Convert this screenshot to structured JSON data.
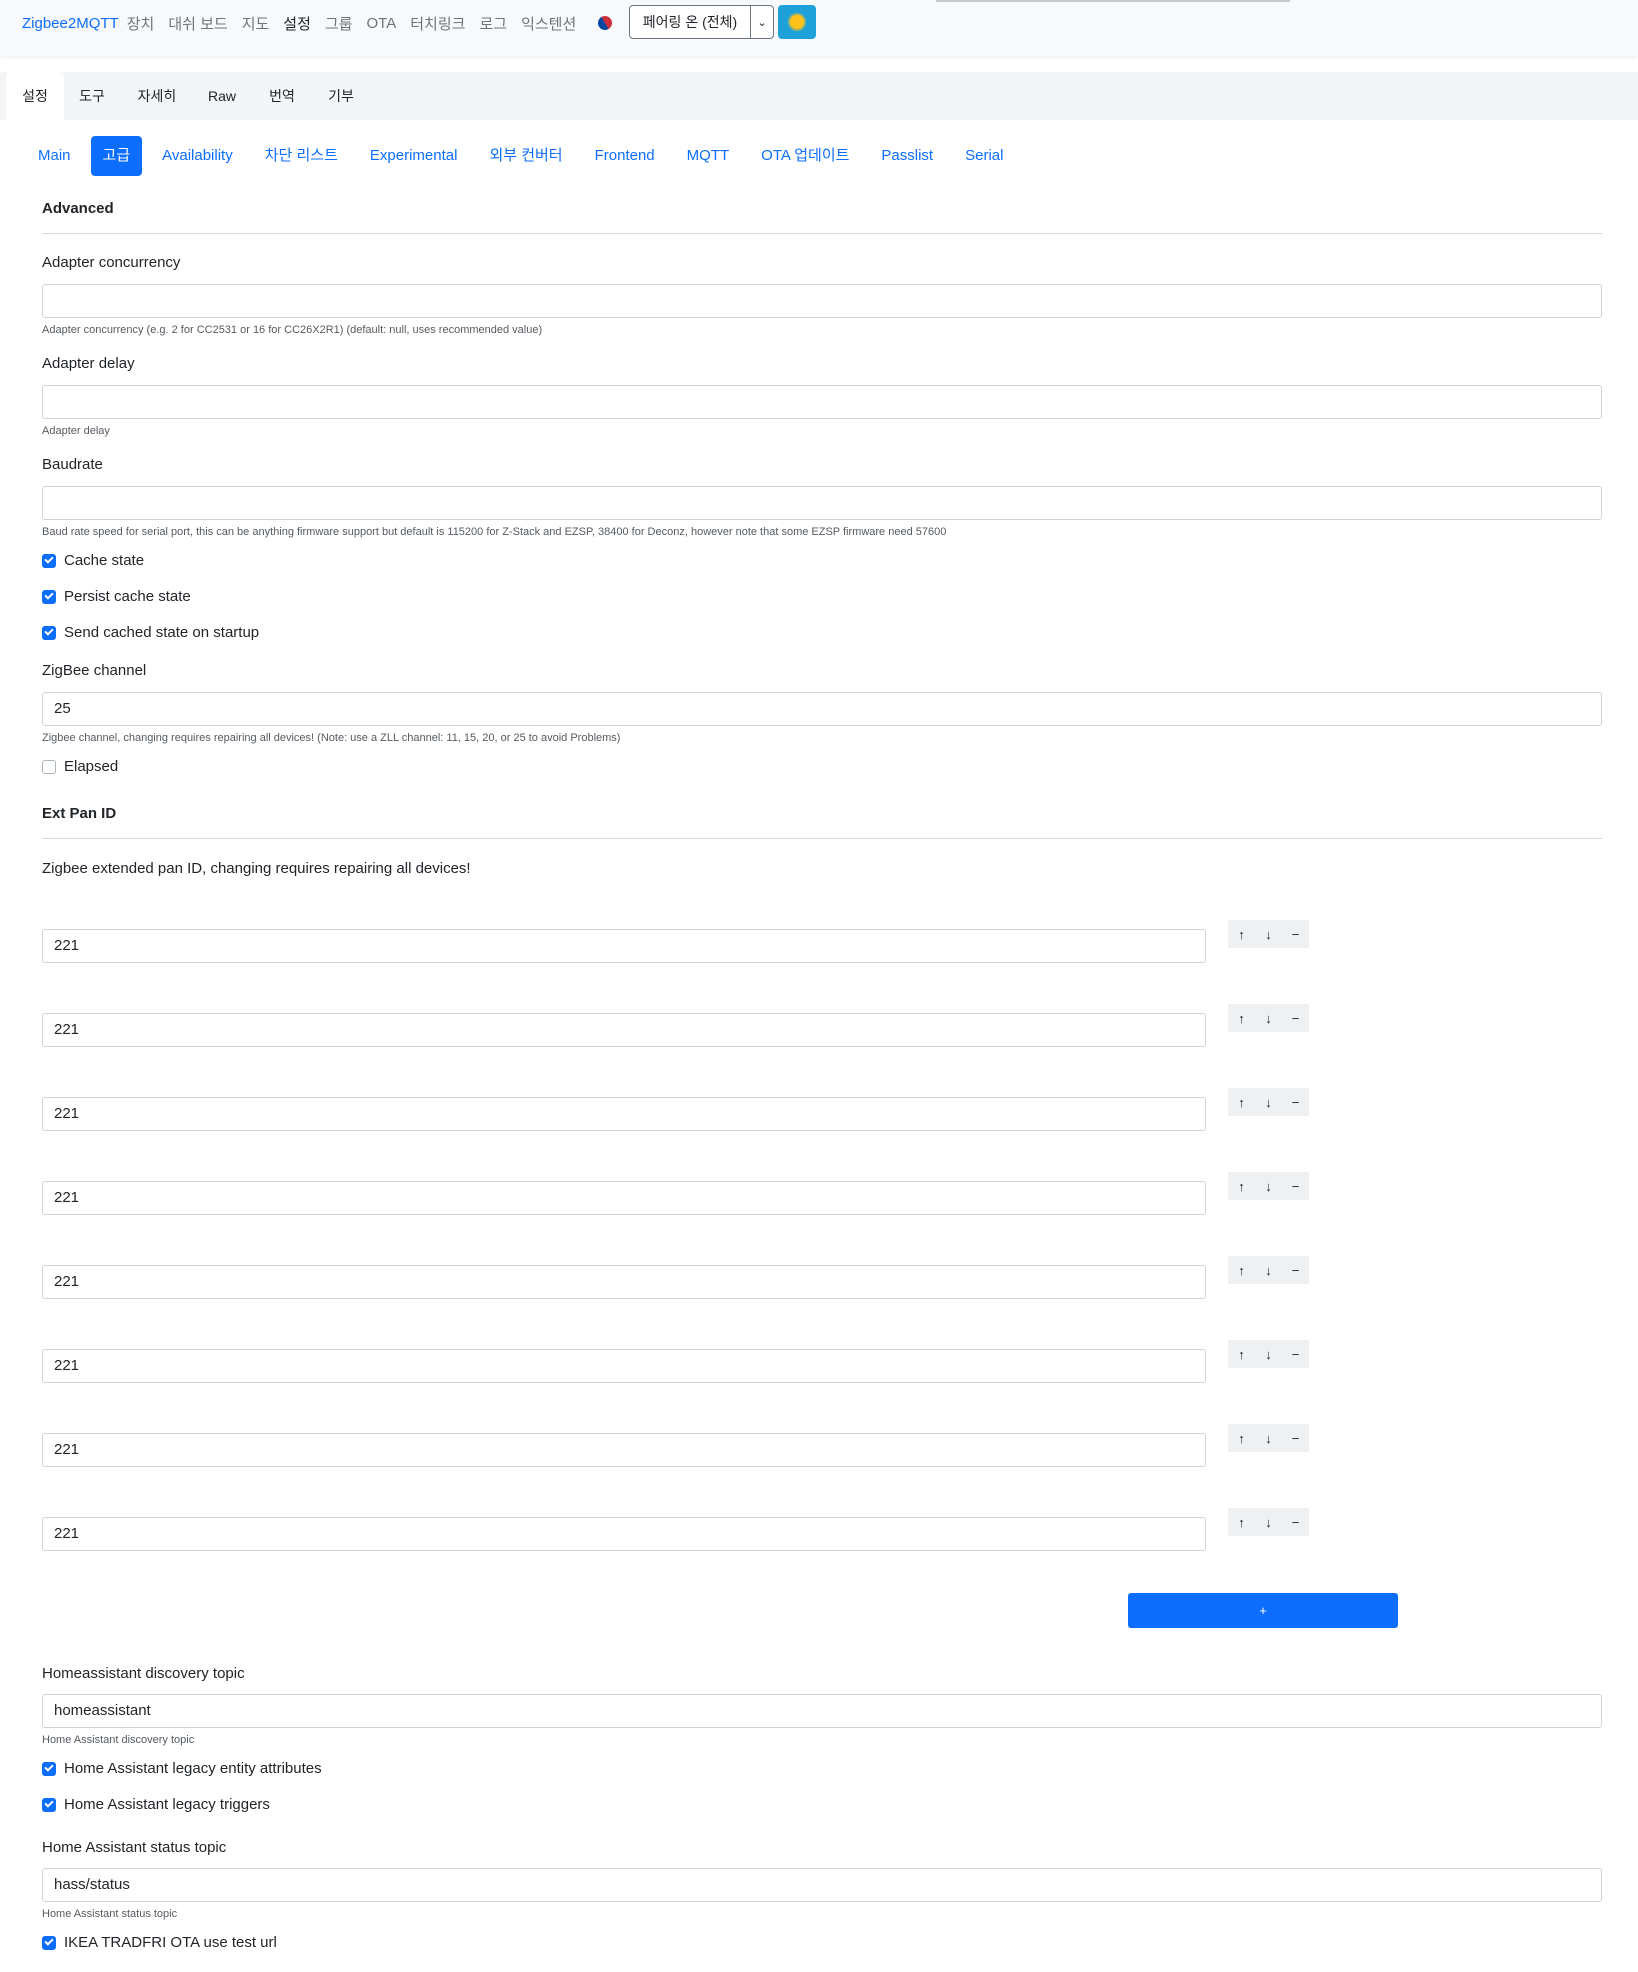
{
  "navbar": {
    "brand": "Zigbee2MQTT",
    "links": [
      "장치",
      "대쉬 보드",
      "지도",
      "설정",
      "그룹",
      "OTA",
      "터치링크",
      "로그",
      "익스텐션"
    ],
    "active_link": "설정",
    "permit_join_label": "페어링 온 (전체)"
  },
  "tabs_top": [
    "설정",
    "도구",
    "자세히",
    "Raw",
    "번역",
    "기부"
  ],
  "tabs_settings": [
    "Main",
    "고급",
    "Availability",
    "차단 리스트",
    "Experimental",
    "외부 컨버터",
    "Frontend",
    "MQTT",
    "OTA 업데이트",
    "Passlist",
    "Serial"
  ],
  "form": {
    "legend": "Advanced",
    "adapter_concurrency": {
      "label": "Adapter concurrency",
      "value": "",
      "help": "Adapter concurrency (e.g. 2 for CC2531 or 16 for CC26X2R1) (default: null, uses recommended value)"
    },
    "adapter_delay": {
      "label": "Adapter delay",
      "value": "",
      "help": "Adapter delay"
    },
    "baudrate": {
      "label": "Baudrate",
      "value": "",
      "help": "Baud rate speed for serial port, this can be anything firmware support but default is 115200 for Z-Stack and EZSP, 38400 for Deconz, however note that some EZSP firmware need 57600"
    },
    "cache_state": {
      "label": "Cache state",
      "checked": true
    },
    "persist_cache_state": {
      "label": "Persist cache state",
      "checked": true
    },
    "send_cached_state": {
      "label": "Send cached state on startup",
      "checked": true
    },
    "zigbee_channel": {
      "label": "ZigBee channel",
      "value": "25",
      "help": "Zigbee channel, changing requires repairing all devices! (Note: use a ZLL channel: 11, 15, 20, or 25 to avoid Problems)"
    },
    "elapsed": {
      "label": "Elapsed",
      "checked": false
    },
    "ext_pan_id": {
      "legend": "Ext Pan ID",
      "description": "Zigbee extended pan ID, changing requires repairing all devices!",
      "values": [
        "221",
        "221",
        "221",
        "221",
        "221",
        "221",
        "221",
        "221"
      ],
      "add_label": "+"
    },
    "ha_discovery_topic": {
      "label": "Homeassistant discovery topic",
      "value": "homeassistant",
      "help": "Home Assistant discovery topic"
    },
    "ha_legacy_entity_attributes": {
      "label": "Home Assistant legacy entity attributes",
      "checked": true
    },
    "ha_legacy_triggers": {
      "label": "Home Assistant legacy triggers",
      "checked": true
    },
    "ha_status_topic": {
      "label": "Home Assistant status topic",
      "value": "hass/status",
      "help": "Home Assistant status topic"
    },
    "ikea_ota_test_url": {
      "label": "IKEA TRADFRI OTA use test url",
      "checked": true
    }
  },
  "icons": {
    "move_up": "↑",
    "move_down": "↓",
    "remove": "−",
    "caret": "⌄"
  },
  "colors": {
    "primary": "#0d6efd",
    "theme_button": "#1da1d8"
  }
}
